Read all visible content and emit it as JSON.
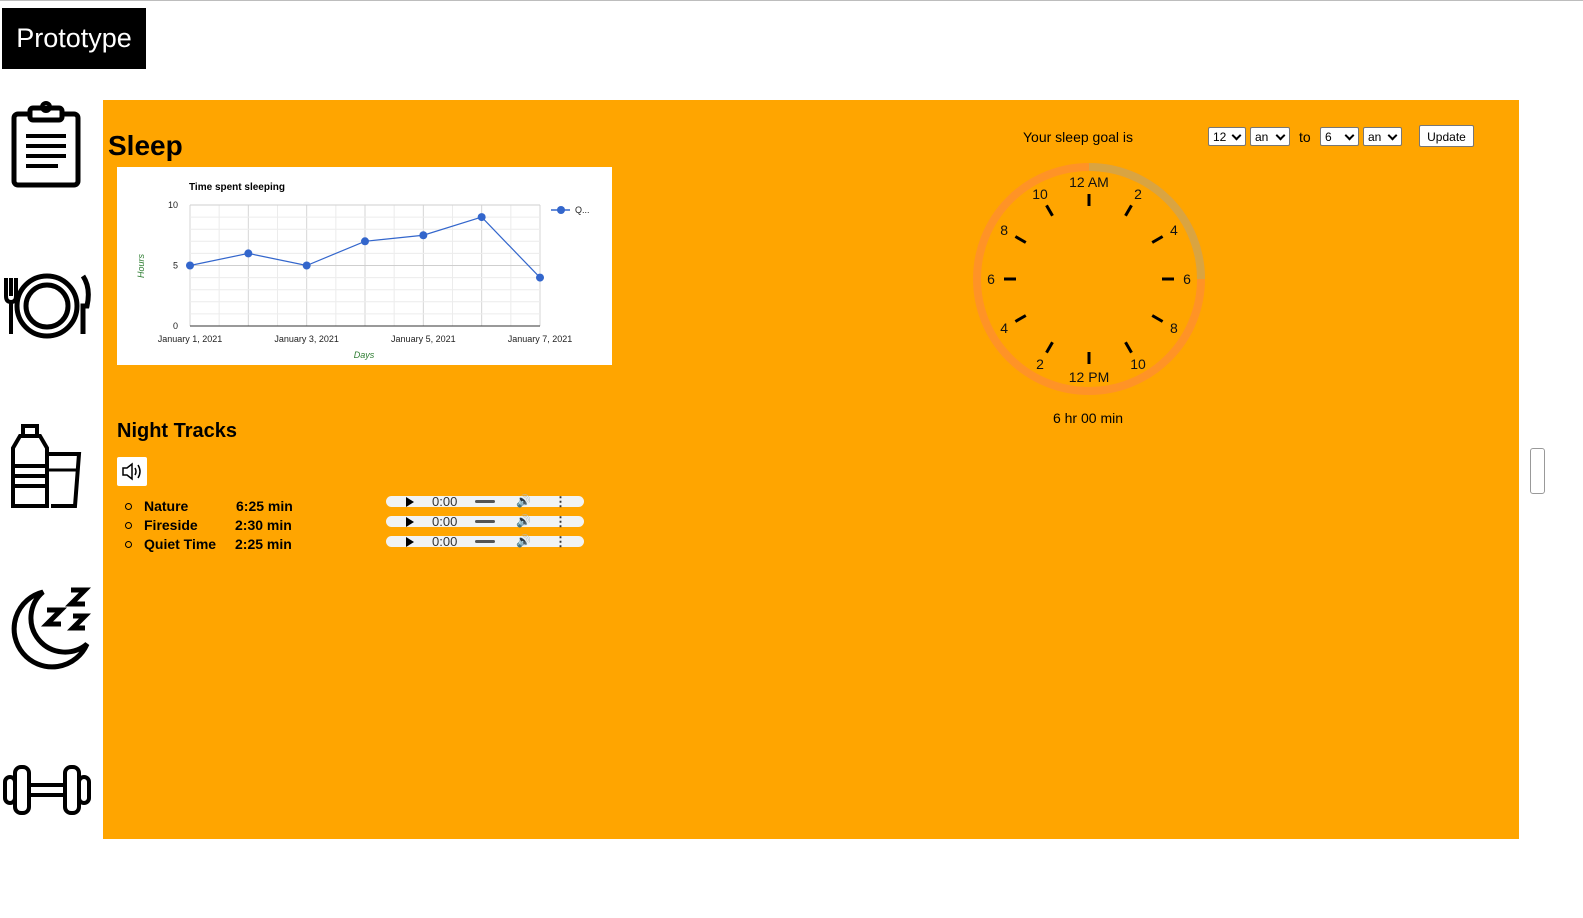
{
  "app": {
    "title": "Prototype"
  },
  "nav": [
    {
      "icon": "clipboard-icon"
    },
    {
      "icon": "plate-fork-knife-icon"
    },
    {
      "icon": "water-bottle-glass-icon"
    },
    {
      "icon": "moon-sleep-icon"
    },
    {
      "icon": "dumbbell-icon"
    }
  ],
  "sleep": {
    "title": "Sleep",
    "goal_label": "Your sleep goal is",
    "from_hour": "12",
    "from_ampm": "an",
    "to_label": "to",
    "to_hour": "6",
    "to_ampm": "an",
    "update_label": "Update",
    "duration": "6 hr 00 min"
  },
  "clock": {
    "top_label": "12 AM",
    "bottom_label": "12 PM",
    "left_numbers": [
      "10",
      "8",
      "6",
      "4",
      "2"
    ],
    "right_numbers": [
      "2",
      "4",
      "6",
      "8",
      "10"
    ],
    "colors": {
      "ring": "#ff9326",
      "goal_arc": "#d9a441"
    },
    "goal_fraction": 0.25
  },
  "chart_data": {
    "type": "line",
    "title": "Time spent sleeping",
    "xlabel": "Days",
    "ylabel": "Hours",
    "x": [
      "January 1, 2021",
      "January 2, 2021",
      "January 3, 2021",
      "January 4, 2021",
      "January 5, 2021",
      "January 6, 2021",
      "January 7, 2021"
    ],
    "x_tick_labels": [
      "January 1, 2021",
      "January 3, 2021",
      "January 5, 2021",
      "January 7, 2021"
    ],
    "series": [
      {
        "name": "Q...",
        "values": [
          5,
          6,
          5,
          7,
          7.5,
          9,
          4
        ],
        "color": "#3366cc"
      }
    ],
    "ylim": [
      0,
      10
    ],
    "yticks": [
      "0",
      "5",
      "10"
    ],
    "grid": true,
    "legend": "top-right"
  },
  "tracks": {
    "title": "Night Tracks",
    "sound_icon": "speaker-icon",
    "items": [
      {
        "name": "Nature",
        "duration": "6:25 min",
        "time": "0:00"
      },
      {
        "name": "Fireside",
        "duration": "2:30 min",
        "time": "0:00"
      },
      {
        "name": "Quiet Time",
        "duration": "2:25 min",
        "time": "0:00"
      }
    ]
  }
}
